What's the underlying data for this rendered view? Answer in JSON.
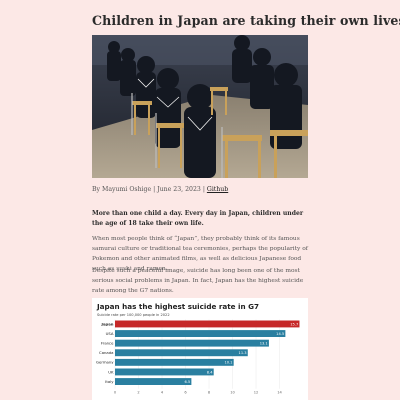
{
  "article": {
    "title": "Children in Japan are taking their own lives",
    "byline": {
      "author": "By Mayumi Oshige",
      "date": "June 23, 2023",
      "separator": "|",
      "link_label": "Github"
    },
    "lead": "More than one child a day. Every day in Japan, children under the age of 18 take their own life.",
    "paragraphs": [
      "When most people think of “Japan”, they probably think of its famous samurai culture or traditional tea ceremonies, perhaps the popularity of Pokemon and other animated films, as well as delicious Japanese food such as sushi and ramen.",
      "Despite such a peaceful image, suicide has long been one of the most serious social problems in Japan. In fact, Japan has the highest suicide rate among the G7 nations."
    ]
  },
  "image": {
    "icon": "students-in-classroom-photo"
  },
  "colors": {
    "background": "#fce8e6",
    "highlight_bar": "#c62828",
    "bar": "#2a7fa0"
  },
  "chart_data": {
    "type": "bar",
    "orientation": "horizontal",
    "title": "Japan has the highest suicide rate in G7",
    "subtitle": "Suicide rate per 100,000 people in 2022",
    "categories": [
      "Japan",
      "USA",
      "France",
      "Canada",
      "Germany",
      "UK",
      "Italy"
    ],
    "values": [
      15.7,
      14.5,
      13.1,
      11.3,
      10.1,
      8.4,
      6.5
    ],
    "value_labels": [
      "15.7",
      "14.5",
      "13.1",
      "11.3",
      "10.1",
      "8.4",
      "6.5"
    ],
    "highlight": "Japan",
    "xlim": [
      0,
      16
    ],
    "xticks": [
      "0",
      "2",
      "4",
      "6",
      "8",
      "10",
      "12",
      "14"
    ],
    "xtick_values": [
      0,
      2,
      4,
      6,
      8,
      10,
      12,
      14
    ],
    "grid": true
  }
}
